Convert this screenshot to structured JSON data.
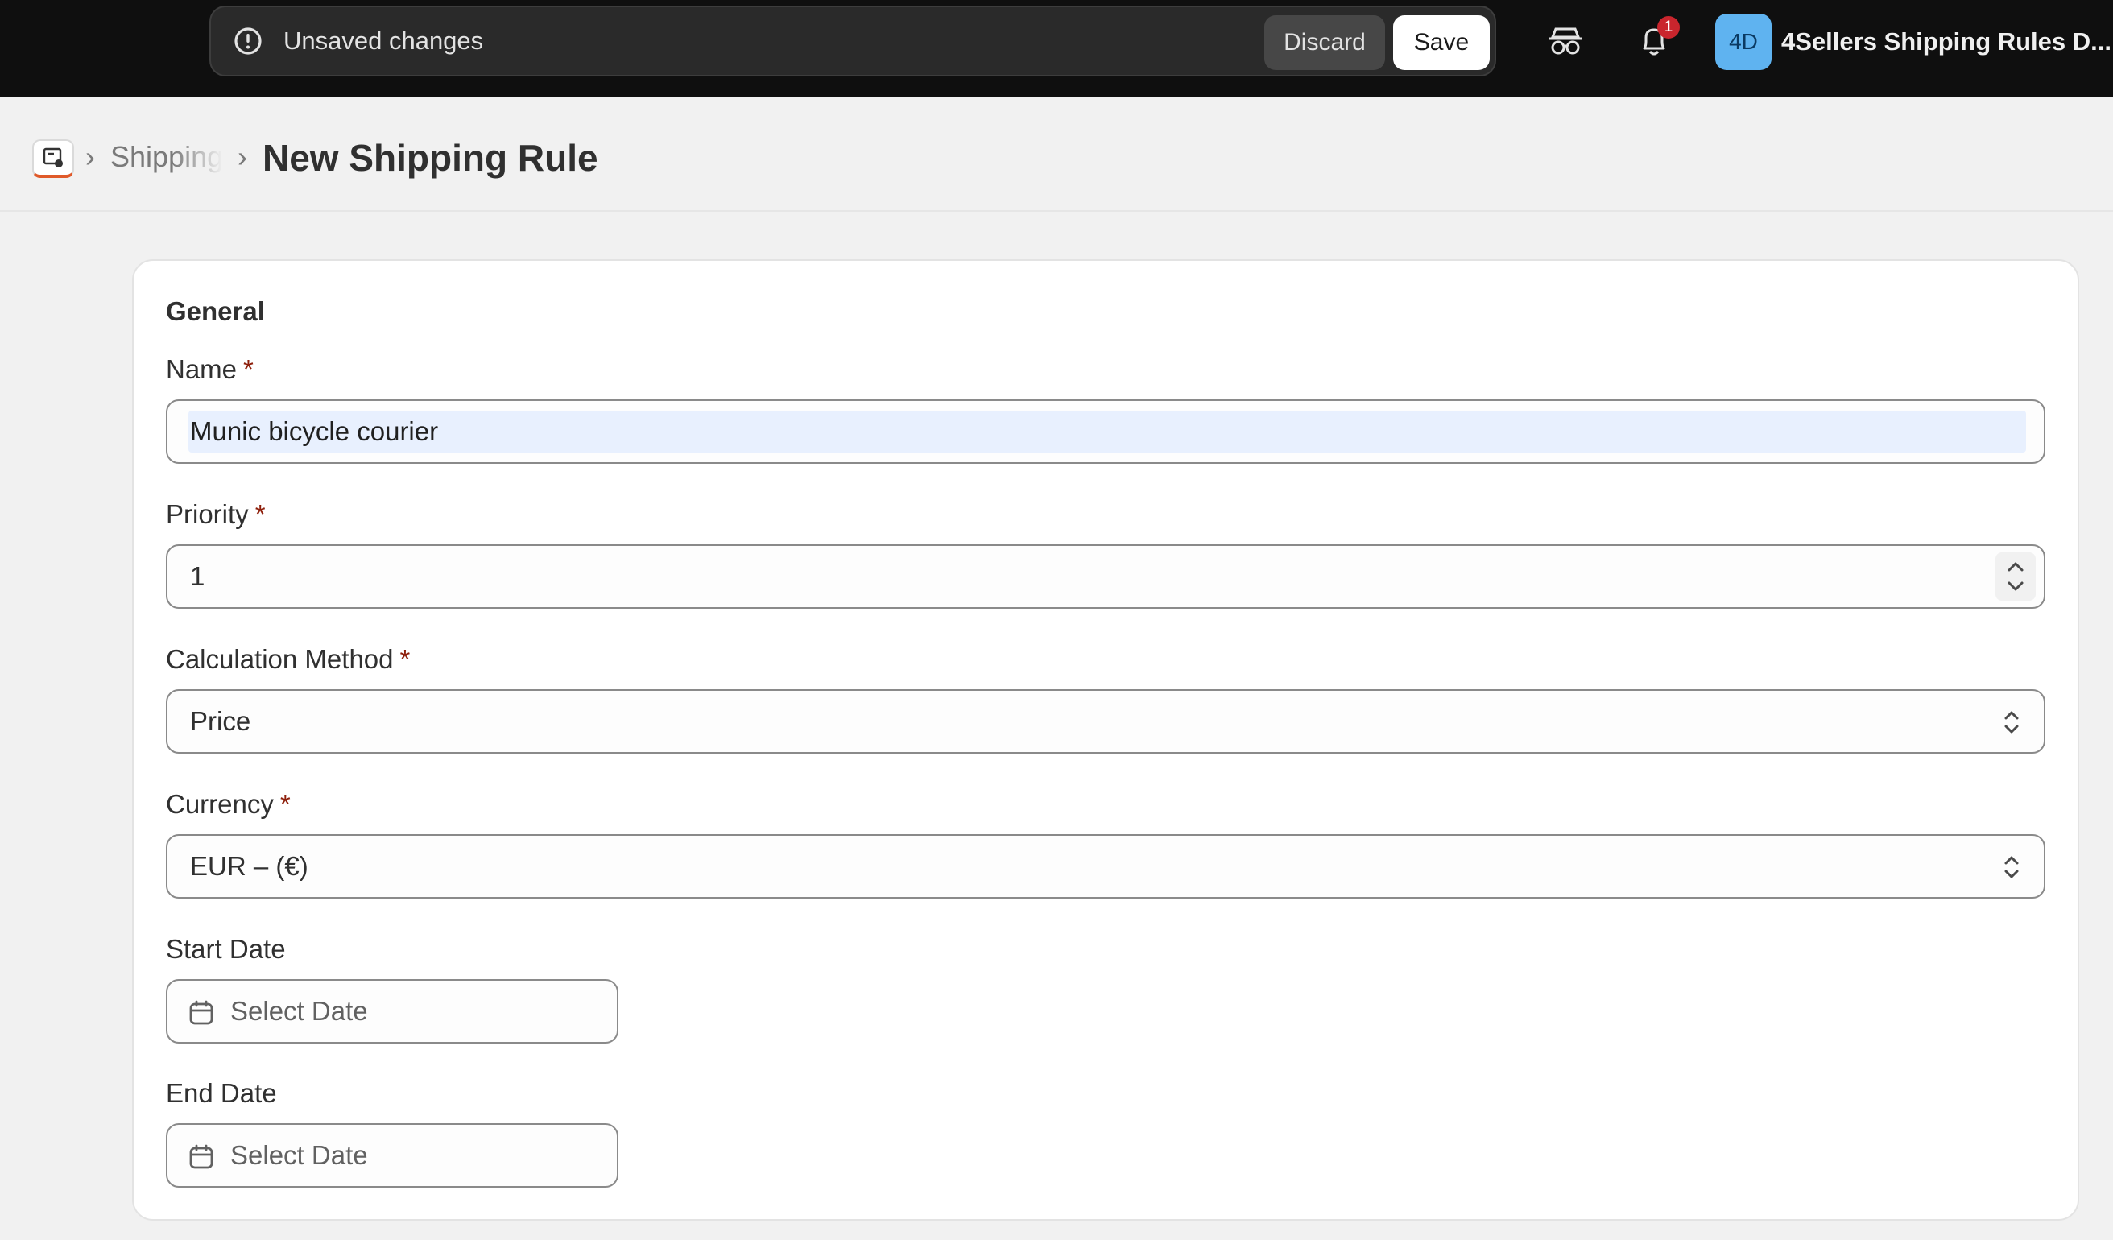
{
  "savebar": {
    "message": "Unsaved changes",
    "discard_label": "Discard",
    "save_label": "Save"
  },
  "topbar": {
    "notification_count": "1",
    "avatar_initials": "4D",
    "store_name": "4Sellers Shipping Rules D..."
  },
  "breadcrumb": {
    "parent": "Shipping",
    "separator": "›",
    "title": "New Shipping Rule"
  },
  "form": {
    "section_title": "General",
    "required_marker": "*",
    "name": {
      "label": "Name",
      "value": "Munic bicycle courier"
    },
    "priority": {
      "label": "Priority",
      "value": "1"
    },
    "calculation_method": {
      "label": "Calculation Method",
      "value": "Price"
    },
    "currency": {
      "label": "Currency",
      "value": "EUR – (€)"
    },
    "start_date": {
      "label": "Start Date",
      "placeholder": "Select Date"
    },
    "end_date": {
      "label": "End Date",
      "placeholder": "Select Date"
    }
  },
  "colors": {
    "topbar_bg": "#0f0f0f",
    "required": "#8e1f0b",
    "badge": "#c9252d",
    "avatar": "#5fb3f0",
    "autofill_bg": "#e8f0fe"
  },
  "icons": [
    "alert-circle-icon",
    "incognito-icon",
    "bell-icon",
    "app-icon",
    "calendar-icon",
    "chevron-up-icon",
    "chevron-down-icon",
    "select-arrows-icon"
  ]
}
